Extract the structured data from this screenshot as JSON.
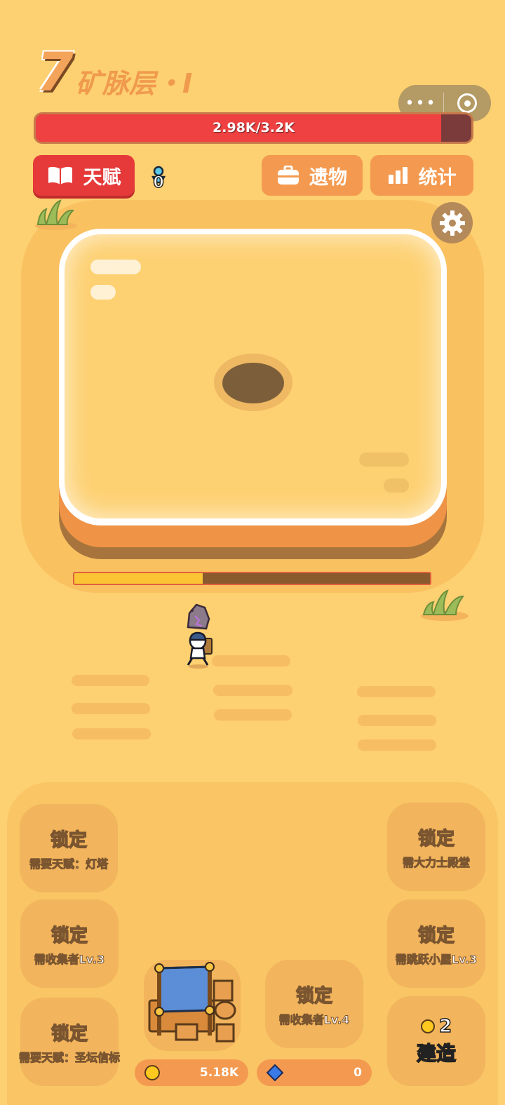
{
  "level": {
    "number": "7",
    "name": "矿脉层・I"
  },
  "hp": {
    "text": "2.98K/3.2K",
    "current": 2.98,
    "max": 3.2
  },
  "buttons": {
    "talent": "天赋",
    "relic": "遗物",
    "stats": "统计"
  },
  "pawn_count": "0",
  "dig_progress": 0.36,
  "tiles": [
    {
      "title": "锁定",
      "sub": "需要天赋：灯塔"
    },
    {
      "title": "锁定",
      "sub": "需收集者Lv.3"
    },
    {
      "title": "锁定",
      "sub": "需要天赋：圣坛信标"
    },
    {
      "title": "锁定",
      "sub": "需大力士殿堂"
    },
    {
      "title": "锁定",
      "sub": "需跳跃小屋Lv.3"
    },
    {
      "title": "锁定",
      "sub": "需收集者Lv.4"
    }
  ],
  "build": {
    "cost": "2",
    "label": "建造"
  },
  "currency": {
    "gold": "5.18K",
    "gems": "0"
  },
  "colors": {
    "background": "#fdd071",
    "accent_red": "#e63a3a",
    "accent_orange": "#f49a50"
  },
  "icons": [
    "book-icon",
    "briefcase-icon",
    "bar-chart-icon",
    "gear-icon",
    "pawn-icon",
    "coin-icon",
    "gem-icon",
    "ore-rock-icon"
  ]
}
